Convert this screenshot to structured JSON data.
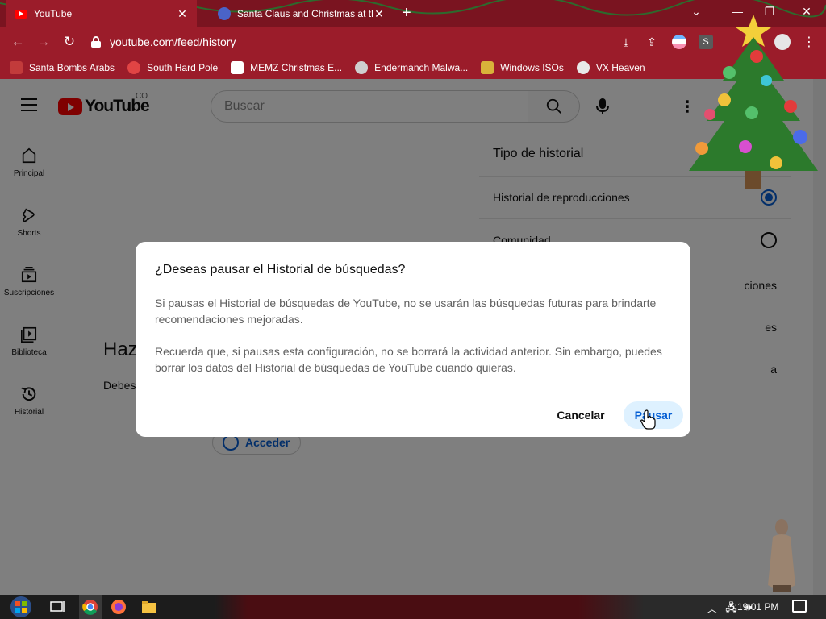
{
  "browser": {
    "tabs": [
      {
        "title": "YouTube",
        "active": true,
        "favicon": "youtube-icon"
      },
      {
        "title": "Santa Claus and Christmas at the",
        "active": false,
        "favicon": "site-icon"
      }
    ],
    "url": "youtube.com/feed/history",
    "bookmarks": [
      {
        "label": "Santa Bombs Arabs",
        "icon": "santa-icon"
      },
      {
        "label": "South Hard Pole",
        "icon": "snowflake-icon"
      },
      {
        "label": "MEMZ Christmas E...",
        "icon": "memz-icon"
      },
      {
        "label": "Endermanch Malwa...",
        "icon": "raccoon-icon"
      },
      {
        "label": "Windows ISOs",
        "icon": "gift-icon"
      },
      {
        "label": "VX Heaven",
        "icon": "vx-icon"
      }
    ],
    "extension_badge": "S"
  },
  "youtube": {
    "logo_text": "YouTube",
    "country_code": "CO",
    "search_placeholder": "Buscar",
    "nav": [
      {
        "label": "Principal",
        "icon": "home-icon"
      },
      {
        "label": "Shorts",
        "icon": "shorts-icon"
      },
      {
        "label": "Suscripciones",
        "icon": "subscriptions-icon"
      },
      {
        "label": "Biblioteca",
        "icon": "library-icon"
      },
      {
        "label": "Historial",
        "icon": "history-icon"
      }
    ],
    "history_panel": {
      "title": "Tipo de historial",
      "options": [
        {
          "label": "Historial de reproducciones",
          "selected": true
        },
        {
          "label": "Comunidad",
          "selected": false
        }
      ],
      "partial_rows": [
        "ciones",
        "es",
        "a"
      ]
    },
    "background": {
      "heading_partial": "Haz",
      "text_partial": "Debes reprod",
      "signin_label": "Acceder"
    }
  },
  "dialog": {
    "title": "¿Deseas pausar el Historial de búsquedas?",
    "paragraph1": "Si pausas el Historial de búsquedas de YouTube, no se usarán las búsquedas futuras para brindarte recomendaciones mejoradas.",
    "paragraph2": "Recuerda que, si pausas esta configuración, no se borrará la actividad anterior. Sin embargo, puedes borrar los datos del Historial de búsquedas de YouTube cuando quieras.",
    "cancel_label": "Cancelar",
    "pause_label": "Pausar"
  },
  "taskbar": {
    "clock": "5:19:01 PM",
    "apps": [
      "start-icon",
      "taskview-icon",
      "chrome-icon",
      "firefox-icon",
      "file-explorer-icon"
    ]
  },
  "colors": {
    "chrome_frame": "#9b1c2a",
    "youtube_red": "#ff0000",
    "link_blue": "#065fd4",
    "pause_button_bg": "#def1ff"
  }
}
